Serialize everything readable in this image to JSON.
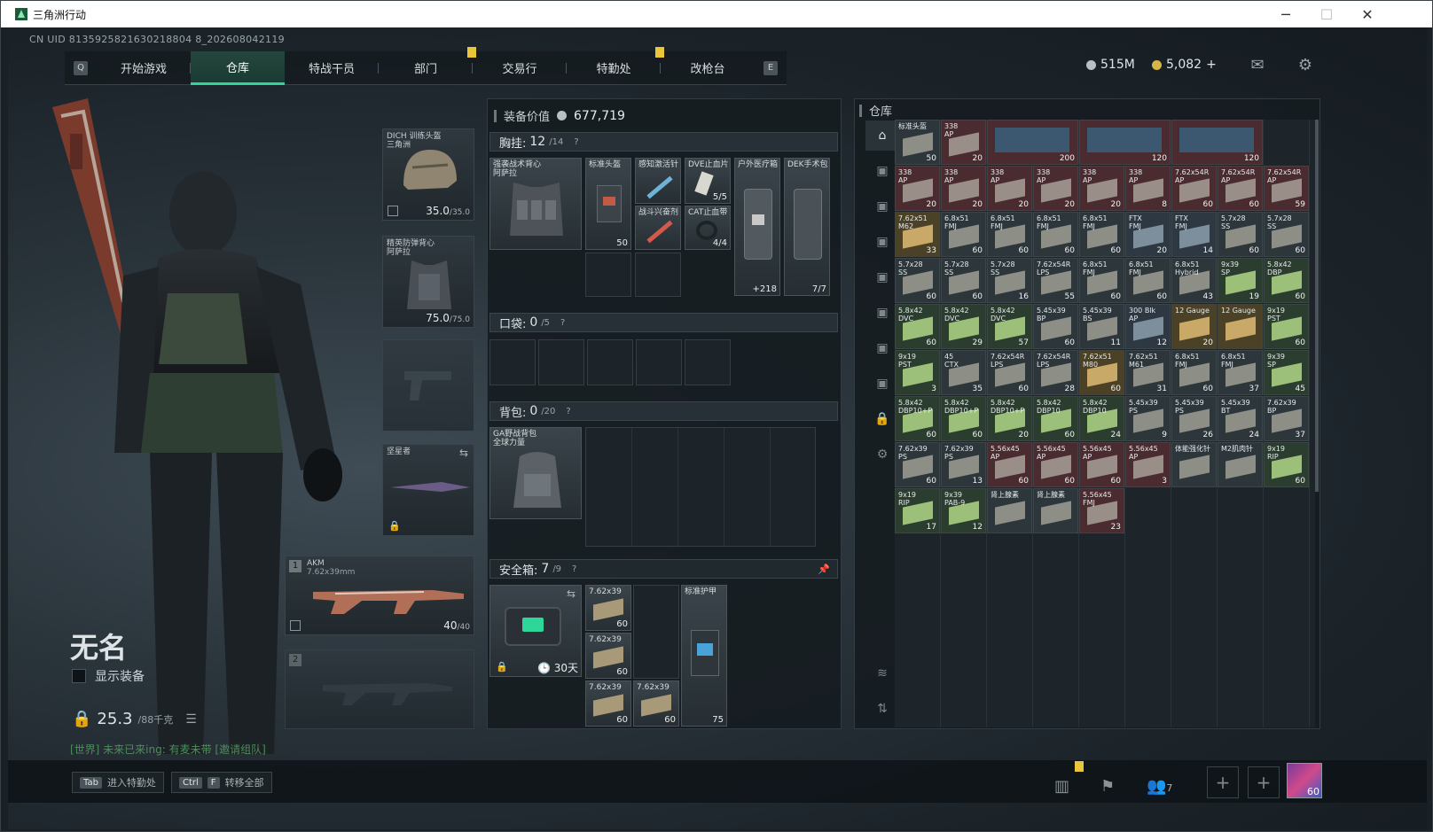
{
  "window": {
    "title": "三角洲行动",
    "minimize": "─",
    "maximize": "☐",
    "close": "✕"
  },
  "uid": "CN UID 8135925821630218804 8_202608042119",
  "nav": {
    "left_key": "Q",
    "right_key": "E",
    "tabs": [
      "开始游戏",
      "仓库",
      "特战干员",
      "部门",
      "交易行",
      "特勤处",
      "改枪台"
    ],
    "active": "仓库"
  },
  "currency": {
    "silver": "515M",
    "gold": "5,082",
    "gold_add": "+"
  },
  "operator": {
    "name": "无名",
    "show_equipment": "显示装备",
    "weight": "25.3",
    "weight_max": "/88千克",
    "chat": "[世界] 未来已来ing: 有麦未带 [邀请组队]"
  },
  "gear": {
    "helmet": {
      "label": "DICH 训练头盔\n三角洲",
      "value": "35.0",
      "max": "/35.0"
    },
    "armor": {
      "label": "精英防弹背心\n阿萨拉",
      "value": "75.0",
      "max": "/75.0"
    },
    "melee": {
      "label": "坚星者"
    },
    "primary": {
      "slot": "1",
      "label": "AKM",
      "caliber": "7.62x39mm",
      "ammo": "40",
      "ammo_max": "/40"
    },
    "secondary": {
      "slot": "2"
    }
  },
  "loadout": {
    "value_label": "装备价值",
    "value": "677,719",
    "chest": {
      "label": "胸挂:",
      "count": "12",
      "max": "/14",
      "help": "?"
    },
    "chest_items": [
      {
        "label": "强袭战术背心\n阿萨拉"
      },
      {
        "label": "标准头盔",
        "count": "50"
      },
      {
        "label": "感知激活针"
      },
      {
        "label": "DVE止血片",
        "count": "5/5"
      },
      {
        "label": "户外医疗箱",
        "count": "218"
      },
      {
        "label": "DEK手术包",
        "count": "7/7"
      },
      {
        "label": "战斗兴奋剂"
      },
      {
        "label": "CAT止血带",
        "count": "4/4"
      }
    ],
    "pocket": {
      "label": "口袋:",
      "count": "0",
      "max": "/5",
      "help": "?"
    },
    "backpack": {
      "label": "背包:",
      "count": "0",
      "max": "/20",
      "help": "?",
      "item": "GA野战背包\n全球力量"
    },
    "safebox": {
      "label": "安全箱:",
      "count": "7",
      "max": "/9",
      "help": "?",
      "time": "30天"
    },
    "safebox_items": [
      {
        "label": "7.62x39",
        "count": "60"
      },
      {
        "label": "7.62x39",
        "count": "60"
      },
      {
        "label": "7.62x39",
        "count": "60"
      },
      {
        "label": "7.62x39",
        "count": "60"
      },
      {
        "label": "标准护甲",
        "count": "75"
      }
    ]
  },
  "storage": {
    "title": "仓库",
    "rows": [
      [
        {
          "l": "标准头盔",
          "c": "50",
          "t": "dark"
        },
        {
          "l": "338\nAP",
          "c": "20",
          "t": "red"
        },
        {
          "l": "",
          "c": "200",
          "t": "red"
        },
        {
          "l": "",
          "c": "",
          "t": "red"
        },
        {
          "l": "",
          "c": "120",
          "t": "red"
        },
        {
          "l": "",
          "c": "",
          "t": "red"
        },
        {
          "l": "",
          "c": "120",
          "t": "red"
        }
      ],
      [
        {
          "l": "338\nAP",
          "c": "20",
          "t": "red"
        },
        {
          "l": "338\nAP",
          "c": "20",
          "t": "red"
        },
        {
          "l": "338\nAP",
          "c": "20",
          "t": "red"
        },
        {
          "l": "338\nAP",
          "c": "20",
          "t": "red"
        },
        {
          "l": "338\nAP",
          "c": "20",
          "t": "red"
        },
        {
          "l": "338\nAP",
          "c": "8",
          "t": "red"
        },
        {
          "l": "7.62x54R\nAP",
          "c": "60",
          "t": "red"
        },
        {
          "l": "7.62x54R\nAP",
          "c": "60",
          "t": "red"
        },
        {
          "l": "7.62x54R\nAP",
          "c": "59",
          "t": "red"
        }
      ],
      [
        {
          "l": "7.62x51\nM62",
          "c": "33",
          "t": "gold"
        },
        {
          "l": "6.8x51\nFMJ",
          "c": "60",
          "t": "dark"
        },
        {
          "l": "6.8x51\nFMJ",
          "c": "60",
          "t": "dark"
        },
        {
          "l": "6.8x51\nFMJ",
          "c": "60",
          "t": "dark"
        },
        {
          "l": "6.8x51\nFMJ",
          "c": "60",
          "t": "dark"
        },
        {
          "l": "FTX\nFMJ",
          "c": "20",
          "t": "blue"
        },
        {
          "l": "FTX\nFMJ",
          "c": "14",
          "t": "blue"
        },
        {
          "l": "5.7x28\nSS",
          "c": "60",
          "t": "dark"
        },
        {
          "l": "5.7x28\nSS",
          "c": "60",
          "t": "dark"
        }
      ],
      [
        {
          "l": "5.7x28\nSS",
          "c": "60",
          "t": "dark"
        },
        {
          "l": "5.7x28\nSS",
          "c": "60",
          "t": "dark"
        },
        {
          "l": "5.7x28\nSS",
          "c": "16",
          "t": "dark"
        },
        {
          "l": "7.62x54R\nLPS",
          "c": "55",
          "t": "dark"
        },
        {
          "l": "6.8x51\nFMJ",
          "c": "60",
          "t": "dark"
        },
        {
          "l": "6.8x51\nFMJ",
          "c": "60",
          "t": "dark"
        },
        {
          "l": "6.8x51\nHybrid",
          "c": "43",
          "t": "dark"
        },
        {
          "l": "9x39\nSP",
          "c": "19",
          "t": "green"
        },
        {
          "l": "5.8x42\nDBP",
          "c": "60",
          "t": "green"
        }
      ],
      [
        {
          "l": "5.8x42\nDVC",
          "c": "60",
          "t": "green"
        },
        {
          "l": "5.8x42\nDVC",
          "c": "29",
          "t": "green"
        },
        {
          "l": "5.8x42\nDVC",
          "c": "57",
          "t": "green"
        },
        {
          "l": "5.45x39\nBP",
          "c": "60",
          "t": "dark"
        },
        {
          "l": "5.45x39\nBS",
          "c": "11",
          "t": "dark"
        },
        {
          "l": "300 Blk\nAP",
          "c": "12",
          "t": "blue"
        },
        {
          "l": "12 Gauge",
          "c": "20",
          "t": "gold"
        },
        {
          "l": "12 Gauge",
          "c": "",
          "t": "gold"
        },
        {
          "l": "9x19\nPST",
          "c": "60",
          "t": "green"
        }
      ],
      [
        {
          "l": "9x19\nPST",
          "c": "3",
          "t": "green"
        },
        {
          "l": "45\nCTX",
          "c": "35",
          "t": "dark"
        },
        {
          "l": "7.62x54R\nLPS",
          "c": "60",
          "t": "dark"
        },
        {
          "l": "7.62x54R\nLPS",
          "c": "28",
          "t": "dark"
        },
        {
          "l": "7.62x51\nM80",
          "c": "60",
          "t": "gold"
        },
        {
          "l": "7.62x51\nM61",
          "c": "31",
          "t": "dark"
        },
        {
          "l": "6.8x51\nFMJ",
          "c": "60",
          "t": "dark"
        },
        {
          "l": "6.8x51\nFMJ",
          "c": "37",
          "t": "dark"
        },
        {
          "l": "9x39\nSP",
          "c": "45",
          "t": "green"
        }
      ],
      [
        {
          "l": "5.8x42\nDBP10+P",
          "c": "60",
          "t": "green"
        },
        {
          "l": "5.8x42\nDBP10+P",
          "c": "60",
          "t": "green"
        },
        {
          "l": "5.8x42\nDBP10+P",
          "c": "20",
          "t": "green"
        },
        {
          "l": "5.8x42\nDBP10",
          "c": "60",
          "t": "green"
        },
        {
          "l": "5.8x42\nDBP10",
          "c": "24",
          "t": "green"
        },
        {
          "l": "5.45x39\nPS",
          "c": "9",
          "t": "dark"
        },
        {
          "l": "5.45x39\nPS",
          "c": "26",
          "t": "dark"
        },
        {
          "l": "5.45x39\nBT",
          "c": "24",
          "t": "dark"
        },
        {
          "l": "7.62x39\nBP",
          "c": "37",
          "t": "dark"
        }
      ],
      [
        {
          "l": "7.62x39\nPS",
          "c": "60",
          "t": "dark"
        },
        {
          "l": "7.62x39\nPS",
          "c": "13",
          "t": "dark"
        },
        {
          "l": "5.56x45\nAP",
          "c": "60",
          "t": "red"
        },
        {
          "l": "5.56x45\nAP",
          "c": "60",
          "t": "red"
        },
        {
          "l": "5.56x45\nAP",
          "c": "60",
          "t": "red"
        },
        {
          "l": "5.56x45\nAP",
          "c": "3",
          "t": "red"
        },
        {
          "l": "体能强化针",
          "c": "",
          "t": "dark"
        },
        {
          "l": "M2肌肉针",
          "c": "",
          "t": "dark"
        },
        {
          "l": "9x19\nRIP",
          "c": "60",
          "t": "green"
        }
      ],
      [
        {
          "l": "9x19\nRIP",
          "c": "17",
          "t": "green"
        },
        {
          "l": "9x39\nPAB-9",
          "c": "12",
          "t": "green"
        },
        {
          "l": "肾上腺素",
          "c": "",
          "t": "dark"
        },
        {
          "l": "肾上腺素",
          "c": "",
          "t": "dark"
        },
        {
          "l": "5.56x45\nFMJ",
          "c": "23",
          "t": "red"
        }
      ]
    ]
  },
  "bottom": {
    "hint1_key": "Tab",
    "hint1": "进入特勤处",
    "hint2_key": "Ctrl",
    "hint2_key2": "F",
    "hint2": "转移全部",
    "friends": "7",
    "level": "60"
  }
}
